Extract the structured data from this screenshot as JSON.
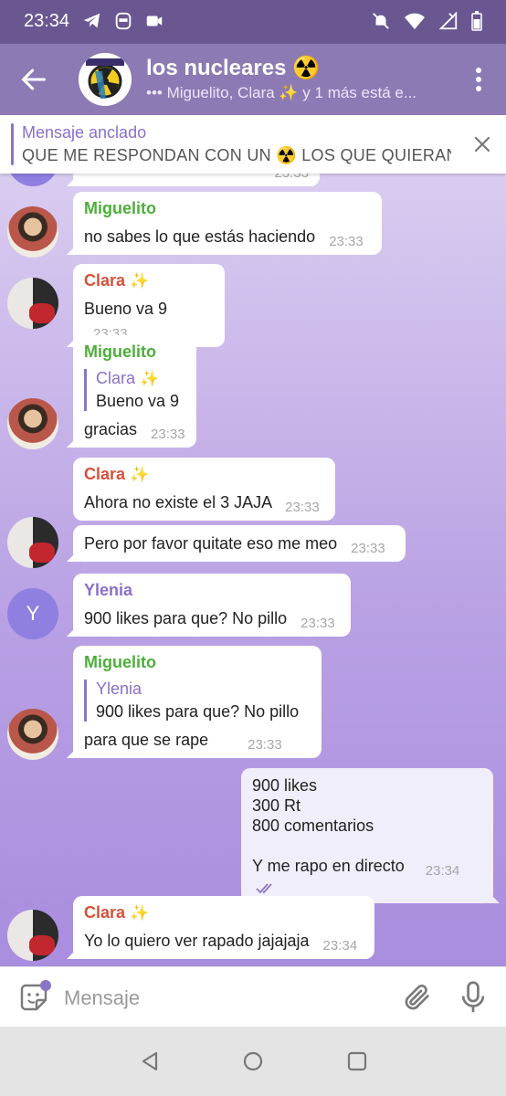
{
  "status_bar": {
    "time": "23:34",
    "icons_left": [
      "telegram-icon",
      "app-icon",
      "video-icon"
    ],
    "icons_right": [
      "mute-bell-icon",
      "wifi-icon",
      "no-signal-icon",
      "battery-icon"
    ]
  },
  "header": {
    "title": "los nucleares",
    "title_emoji": "☢️",
    "subtitle": "••• Miguelito, Clara ✨ y 1 más está e..."
  },
  "pinned": {
    "title": "Mensaje anclado",
    "text": "QUE ME RESPONDAN CON UN ☢️ LOS QUE QUIERAN P..."
  },
  "messages": [
    {
      "partial_time": "23:33"
    },
    {
      "sender": "Miguelito",
      "text": "no sabes lo que estás haciendo",
      "time": "23:33"
    },
    {
      "sender": "Clara",
      "sparkle": "✨",
      "text": "Bueno va 9",
      "time": "23:33"
    },
    {
      "sender": "Miguelito",
      "reply_name": "Clara",
      "reply_sparkle": "✨",
      "reply_text": "Bueno va 9",
      "text": "gracias",
      "time": "23:33"
    },
    {
      "sender": "Clara",
      "sparkle": "✨",
      "text": "Ahora no existe el 3 JAJA",
      "time": "23:33"
    },
    {
      "text": "Pero por favor quitate eso me meo",
      "time": "23:33"
    },
    {
      "sender": "Ylenia",
      "avatar_letter": "Y",
      "text": "900 likes para que? No pillo",
      "time": "23:33"
    },
    {
      "sender": "Miguelito",
      "reply_name": "Ylenia",
      "reply_text": "900 likes para que? No pillo",
      "text": "para que se rape",
      "time": "23:33"
    },
    {
      "lines": [
        "900 likes",
        "300 Rt",
        "800 comentarios",
        "",
        "Y me rapo en directo"
      ],
      "time": "23:34",
      "status": "read"
    },
    {
      "sender": "Clara",
      "sparkle": "✨",
      "text": "Yo lo quiero ver rapado jajajaja",
      "time": "23:34"
    }
  ],
  "input": {
    "placeholder": "Mensaje"
  },
  "colors": {
    "header": "#8c7ab4",
    "status_bar": "#6a5792",
    "sender_miguelito": "#4caf39",
    "sender_clara": "#d9503a",
    "sender_ylenia": "#8a6fc9",
    "accent": "#8a76c6"
  }
}
